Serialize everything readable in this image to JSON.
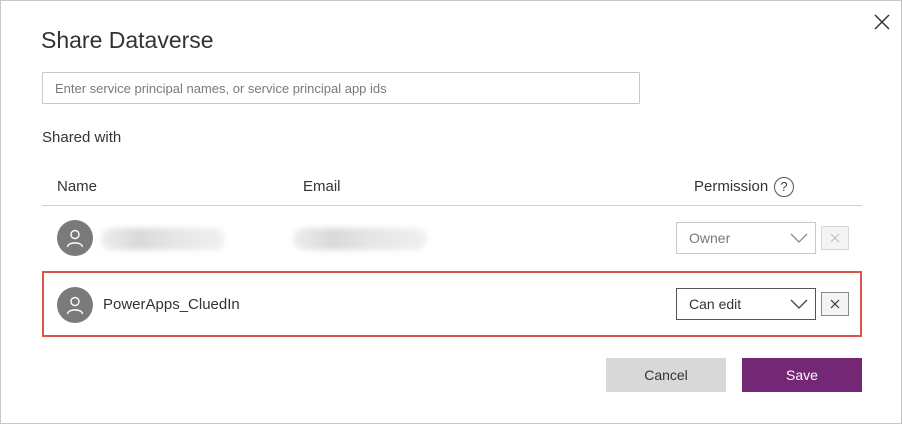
{
  "dialog": {
    "title": "Share Dataverse",
    "close_icon": "close-icon"
  },
  "search": {
    "placeholder": "Enter service principal names, or service principal app ids",
    "value": ""
  },
  "shared_with_label": "Shared with",
  "table": {
    "columns": {
      "name": "Name",
      "email": "Email",
      "permission": "Permission",
      "help_glyph": "?"
    },
    "rows": [
      {
        "name": "",
        "email": "",
        "name_obscured": true,
        "permission": "Owner",
        "permission_enabled": false,
        "remove_enabled": false
      },
      {
        "name": "PowerApps_CluedIn",
        "email": "",
        "permission": "Can edit",
        "permission_enabled": true,
        "remove_enabled": true,
        "highlighted": true
      }
    ]
  },
  "actions": {
    "cancel_label": "Cancel",
    "save_label": "Save"
  },
  "colors": {
    "accent": "#742774",
    "highlight_border": "#d9534f",
    "avatar": "#7a7a7a",
    "secondary_button": "#d8d8d8"
  }
}
